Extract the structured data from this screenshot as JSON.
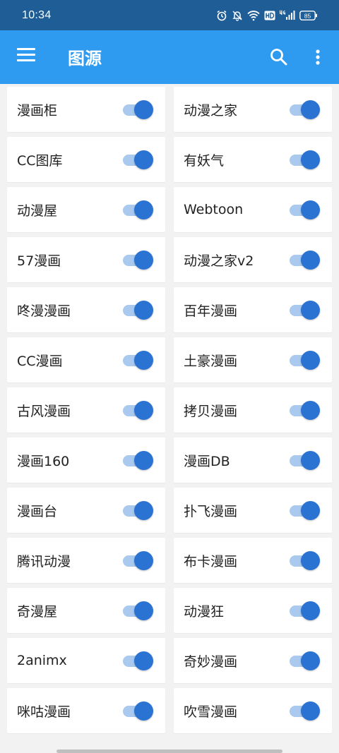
{
  "status_bar": {
    "time": "10:34",
    "battery": "85"
  },
  "app_bar": {
    "title": "图源"
  },
  "colors": {
    "status_bg": "#1E5D96",
    "app_bar": "#2E9BF0",
    "toggle_on": "#2B73D2",
    "toggle_track": "#A9C9EE"
  },
  "sources": [
    {
      "label": "漫画柜",
      "enabled": true
    },
    {
      "label": "动漫之家",
      "enabled": true
    },
    {
      "label": "CC图库",
      "enabled": true
    },
    {
      "label": "有妖气",
      "enabled": true
    },
    {
      "label": "动漫屋",
      "enabled": true
    },
    {
      "label": "Webtoon",
      "enabled": true
    },
    {
      "label": "57漫画",
      "enabled": true
    },
    {
      "label": "动漫之家v2",
      "enabled": true
    },
    {
      "label": "咚漫漫画",
      "enabled": true
    },
    {
      "label": "百年漫画",
      "enabled": true
    },
    {
      "label": "CC漫画",
      "enabled": true
    },
    {
      "label": "土豪漫画",
      "enabled": true
    },
    {
      "label": "古风漫画",
      "enabled": true
    },
    {
      "label": "拷贝漫画",
      "enabled": true
    },
    {
      "label": "漫画160",
      "enabled": true
    },
    {
      "label": "漫画DB",
      "enabled": true
    },
    {
      "label": "漫画台",
      "enabled": true
    },
    {
      "label": "扑飞漫画",
      "enabled": true
    },
    {
      "label": "腾讯动漫",
      "enabled": true
    },
    {
      "label": "布卡漫画",
      "enabled": true
    },
    {
      "label": "奇漫屋",
      "enabled": true
    },
    {
      "label": "动漫狂",
      "enabled": true
    },
    {
      "label": "2animx",
      "enabled": true
    },
    {
      "label": "奇妙漫画",
      "enabled": true
    },
    {
      "label": "咪咕漫画",
      "enabled": true
    },
    {
      "label": "吹雪漫画",
      "enabled": true
    }
  ]
}
